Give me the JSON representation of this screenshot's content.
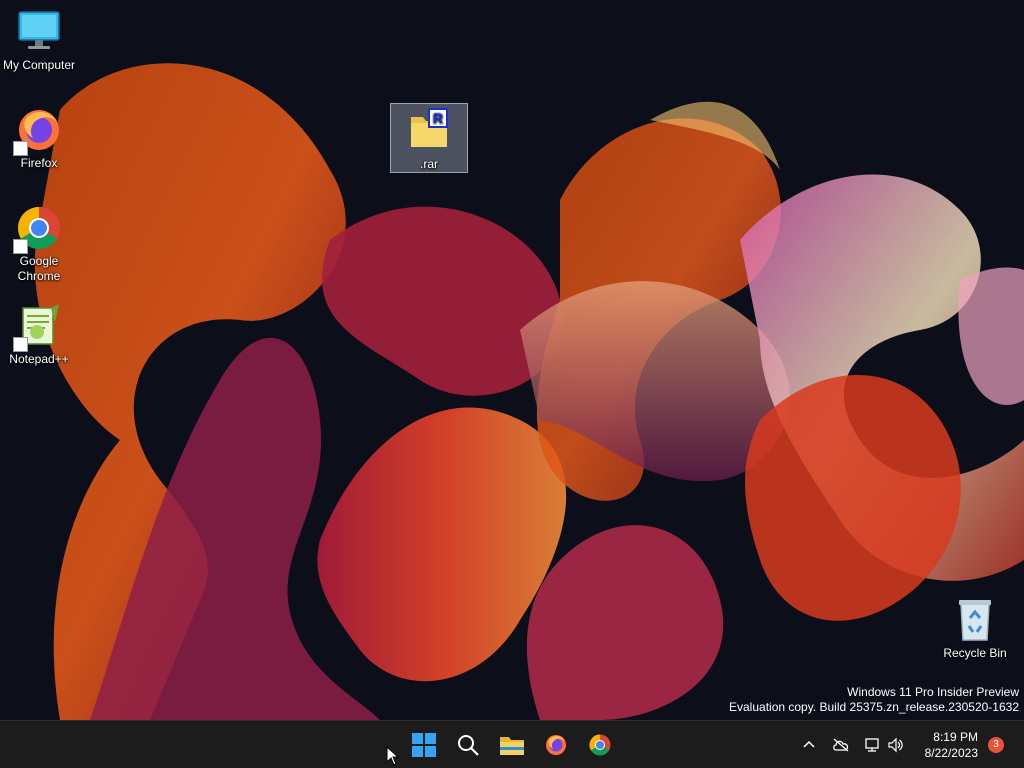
{
  "desktop": {
    "icons": [
      {
        "label": "My Computer"
      },
      {
        "label": "Firefox"
      },
      {
        "label": "Google Chrome"
      },
      {
        "label": "Notepad++"
      },
      {
        "label": ".rar"
      },
      {
        "label": "Recycle Bin"
      }
    ],
    "rar_badge": "R",
    "watermark": {
      "line1": "Windows 11 Pro Insider Preview",
      "line2": "Evaluation copy. Build 25375.zn_release.230520-1632"
    }
  },
  "taskbar": {
    "pinned": [
      "start-icon",
      "search-icon",
      "file-explorer-icon",
      "firefox-icon",
      "chrome-icon"
    ],
    "clock": {
      "time": "8:19 PM",
      "date": "8/22/2023"
    },
    "notification_count": "3"
  },
  "colors": {
    "taskbar_bg": "#1c1c1c",
    "accent": "#0a84ff",
    "badge": "#e5533b"
  }
}
